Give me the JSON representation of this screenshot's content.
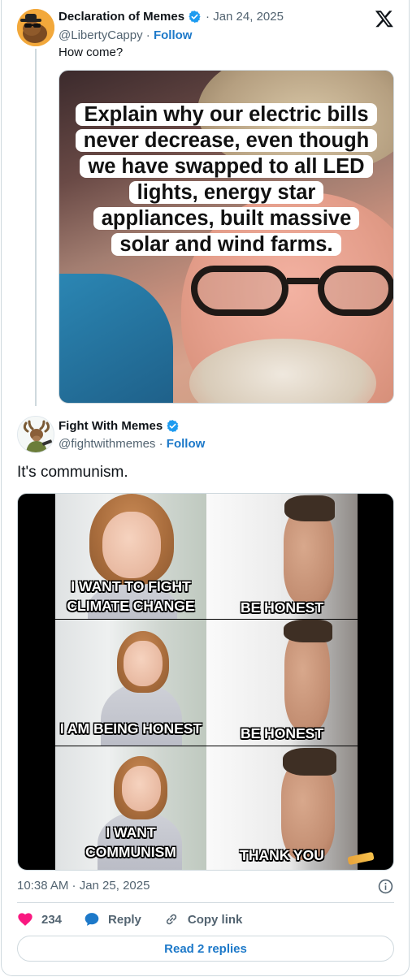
{
  "parent_tweet": {
    "display_name": "Declaration of Memes",
    "date": "· Jan 24, 2025",
    "handle": "@LibertyCappy",
    "follow_label": "Follow",
    "text": "How come?",
    "meme_caption_lines": [
      "Explain why our electric bills",
      "never decrease, even though",
      "we have swapped to all LED",
      "lights, energy star",
      "appliances, built massive",
      "solar and wind farms."
    ]
  },
  "main_tweet": {
    "display_name": "Fight With Memes",
    "handle": "@fightwithmemes",
    "follow_label": "Follow",
    "text": "It's communism.",
    "meme_panels": {
      "left": [
        [
          "I WANT TO FIGHT",
          "CLIMATE CHANGE"
        ],
        [
          "I AM BEING HONEST"
        ],
        [
          "I WANT",
          "COMMUNISM"
        ]
      ],
      "right": [
        [
          "BE HONEST"
        ],
        [
          "BE HONEST"
        ],
        [
          "THANK YOU"
        ]
      ]
    },
    "timestamp": "10:38 AM · Jan 25, 2025",
    "actions": {
      "like_count": "234",
      "reply_label": "Reply",
      "copy_link_label": "Copy link"
    },
    "read_replies_label": "Read 2 replies"
  },
  "icons": {
    "verified": "verified-badge-icon",
    "platform": "x-logo-icon",
    "info": "info-icon",
    "like": "heart-icon",
    "reply": "speech-bubble-icon",
    "copy_link": "link-icon"
  },
  "colors": {
    "link_blue": "#1d79c9",
    "verified_blue": "#1d9bf0",
    "like_pink": "#f91880",
    "secondary_text": "#536471",
    "border": "#cfd9de"
  }
}
